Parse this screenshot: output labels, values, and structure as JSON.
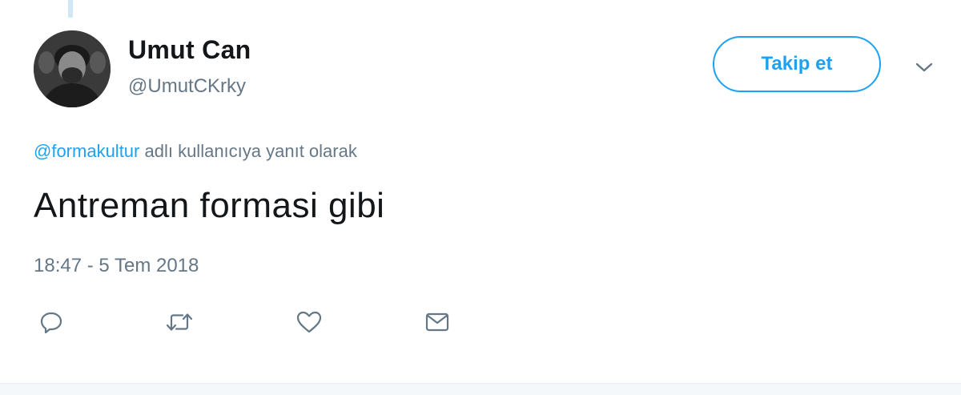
{
  "user": {
    "name": "Umut Can",
    "handle": "@UmutCKrky"
  },
  "follow": {
    "label": "Takip et"
  },
  "reply_context": {
    "mention": "@formakultur",
    "suffix": " adlı kullanıcıya yanıt olarak"
  },
  "tweet": {
    "text": "Antreman formasi gibi",
    "timestamp": "18:47 - 5 Tem 2018"
  },
  "icons": {
    "more": "chevron-down-icon",
    "reply": "reply-icon",
    "retweet": "retweet-icon",
    "like": "heart-icon",
    "dm": "mail-icon"
  },
  "colors": {
    "accent": "#1da1f2",
    "muted": "#657786",
    "text": "#14171a",
    "thread_line": "#cfe7f6"
  }
}
